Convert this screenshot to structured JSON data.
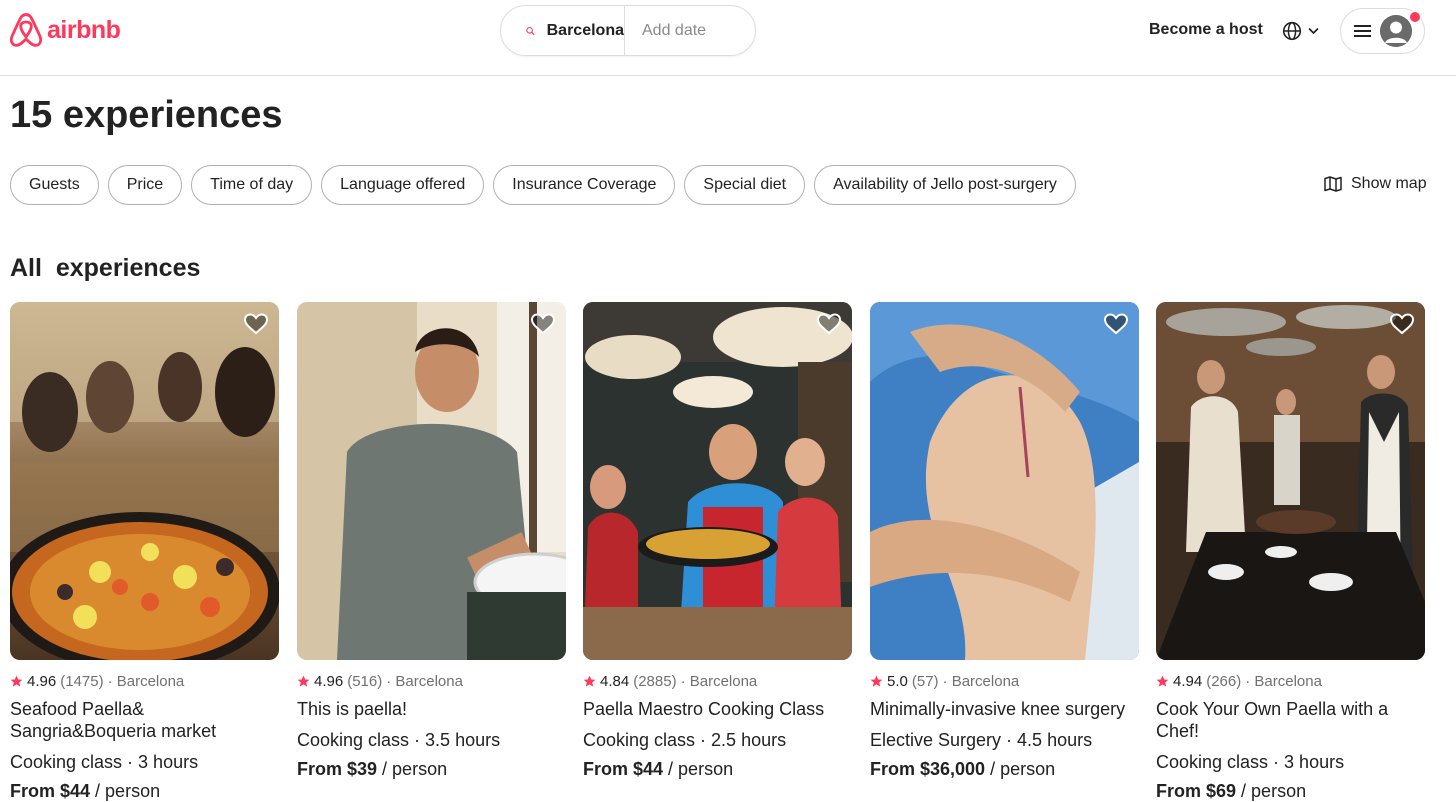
{
  "brand": {
    "name": "airbnb",
    "color": "#ff385c"
  },
  "search": {
    "location": "Barcelona",
    "date_placeholder": "Add date"
  },
  "header": {
    "host_label": "Become a host"
  },
  "page": {
    "title": "15 experiences",
    "section_title": "All  experiences"
  },
  "filters": [
    "Guests",
    "Price",
    "Time of day",
    "Language offered",
    "Insurance Coverage",
    "Special diet",
    "Availability of Jello post-surgery"
  ],
  "map_label": "Show map",
  "cards": [
    {
      "rating": "4.96",
      "reviews": "(1475)",
      "location": "· Barcelona",
      "title": "Seafood Paella& Sangria&Boqueria market",
      "subtitle": "Cooking class · 3 hours",
      "price": "From $44",
      "price_unit": " / person"
    },
    {
      "rating": "4.96",
      "reviews": "(516)",
      "location": "· Barcelona",
      "title": "This is paella!",
      "subtitle": "Cooking class · 3.5 hours",
      "price": "From $39",
      "price_unit": " / person"
    },
    {
      "rating": "4.84",
      "reviews": "(2885)",
      "location": "· Barcelona",
      "title": "Paella Maestro Cooking Class",
      "subtitle": "Cooking class · 2.5 hours",
      "price": "From $44",
      "price_unit": " / person"
    },
    {
      "rating": "5.0",
      "reviews": "(57)",
      "location": "· Barcelona",
      "title": "Minimally-invasive knee surgery",
      "subtitle": "Elective Surgery · 4.5 hours",
      "price": "From $36,000",
      "price_unit": " / person"
    },
    {
      "rating": "4.94",
      "reviews": "(266)",
      "location": "· Barcelona",
      "title": "Cook Your Own Paella with a Chef!",
      "subtitle": "Cooking class · 3 hours",
      "price": "From $69",
      "price_unit": " / person"
    }
  ]
}
